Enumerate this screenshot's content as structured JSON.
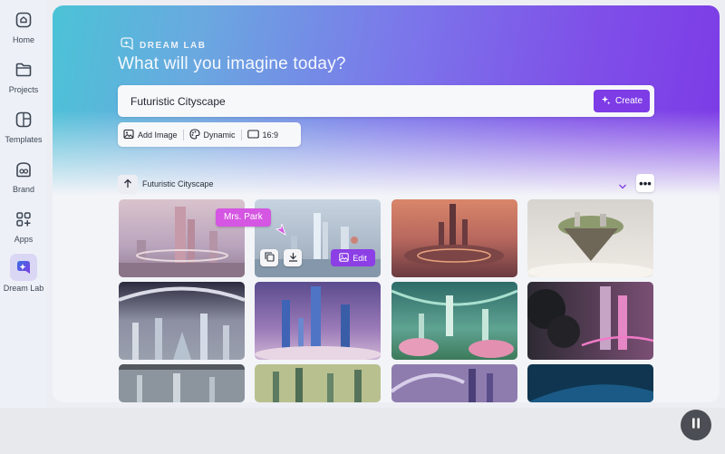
{
  "sidebar": {
    "items": [
      {
        "label": "Home",
        "icon": "home-icon"
      },
      {
        "label": "Projects",
        "icon": "folder-icon"
      },
      {
        "label": "Templates",
        "icon": "templates-icon"
      },
      {
        "label": "Brand",
        "icon": "brand-icon"
      },
      {
        "label": "Apps",
        "icon": "apps-icon"
      },
      {
        "label": "Dream Lab",
        "icon": "dream-lab-icon",
        "active": true
      }
    ]
  },
  "header": {
    "brand_label": "DREAM LAB",
    "headline": "What will you imagine today?"
  },
  "prompt": {
    "value": "Futuristic Cityscape",
    "create_label": "Create"
  },
  "options": {
    "add_image": "Add Image",
    "style": "Dynamic",
    "ratio": "16:9"
  },
  "history": {
    "label": "Futuristic Cityscape",
    "more": "•••"
  },
  "hover": {
    "collaborator_tag": "Mrs. Park",
    "edit_label": "Edit"
  },
  "colors": {
    "accent": "#7d3ce6",
    "tag": "#d556e2"
  }
}
